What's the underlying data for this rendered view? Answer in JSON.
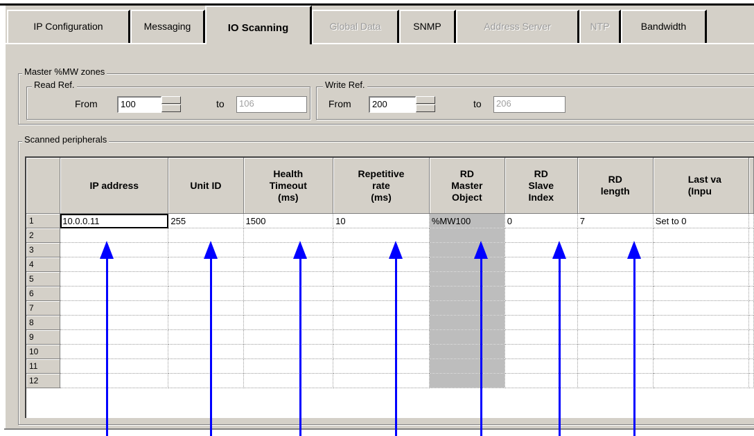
{
  "tabs": [
    {
      "label": "IP Configuration",
      "state": "normal"
    },
    {
      "label": "Messaging",
      "state": "normal"
    },
    {
      "label": "IO Scanning",
      "state": "active"
    },
    {
      "label": "Global Data",
      "state": "disabled"
    },
    {
      "label": "SNMP",
      "state": "normal"
    },
    {
      "label": "Address Server",
      "state": "disabled"
    },
    {
      "label": "NTP",
      "state": "disabled"
    },
    {
      "label": "Bandwidth",
      "state": "normal"
    }
  ],
  "master_zones": {
    "title": "Master %MW zones",
    "read": {
      "title": "Read Ref.",
      "from_label": "From",
      "from_value": "100",
      "to_label": "to",
      "to_value": "106"
    },
    "write": {
      "title": "Write Ref.",
      "from_label": "From",
      "from_value": "200",
      "to_label": "to",
      "to_value": "206"
    }
  },
  "peripherals": {
    "title": "Scanned peripherals",
    "columns": [
      {
        "line1": "IP address",
        "line2": "",
        "line3": ""
      },
      {
        "line1": "Unit ID",
        "line2": "",
        "line3": ""
      },
      {
        "line1": "Health",
        "line2": "Timeout",
        "line3": "(ms)"
      },
      {
        "line1": "Repetitive",
        "line2": "rate",
        "line3": "(ms)"
      },
      {
        "line1": "RD",
        "line2": "Master",
        "line3": "Object"
      },
      {
        "line1": "RD",
        "line2": "Slave",
        "line3": "Index"
      },
      {
        "line1": "RD",
        "line2": "length",
        "line3": ""
      },
      {
        "line1": "Last va",
        "line2": "(Inpu",
        "line3": ""
      }
    ],
    "rows": [
      {
        "num": "1",
        "cells": [
          "10.0.0.11",
          "255",
          "1500",
          "10",
          "%MW100",
          "0",
          "7",
          "Set to 0"
        ]
      },
      {
        "num": "2",
        "cells": [
          "",
          "",
          "",
          "",
          "",
          "",
          "",
          ""
        ]
      },
      {
        "num": "3",
        "cells": [
          "",
          "",
          "",
          "",
          "",
          "",
          "",
          ""
        ]
      },
      {
        "num": "4",
        "cells": [
          "",
          "",
          "",
          "",
          "",
          "",
          "",
          ""
        ]
      },
      {
        "num": "5",
        "cells": [
          "",
          "",
          "",
          "",
          "",
          "",
          "",
          ""
        ]
      },
      {
        "num": "6",
        "cells": [
          "",
          "",
          "",
          "",
          "",
          "",
          "",
          ""
        ]
      },
      {
        "num": "7",
        "cells": [
          "",
          "",
          "",
          "",
          "",
          "",
          "",
          ""
        ]
      },
      {
        "num": "8",
        "cells": [
          "",
          "",
          "",
          "",
          "",
          "",
          "",
          ""
        ]
      },
      {
        "num": "9",
        "cells": [
          "",
          "",
          "",
          "",
          "",
          "",
          "",
          ""
        ]
      },
      {
        "num": "10",
        "cells": [
          "",
          "",
          "",
          "",
          "",
          "",
          "",
          ""
        ]
      },
      {
        "num": "11",
        "cells": [
          "",
          "",
          "",
          "",
          "",
          "",
          "",
          ""
        ]
      },
      {
        "num": "12",
        "cells": [
          "",
          "",
          "",
          "",
          "",
          "",
          "",
          ""
        ]
      }
    ]
  },
  "colors": {
    "arrow": "#0000ff",
    "panel": "#d4d0c8",
    "grey_column": "#bdbdbd"
  }
}
